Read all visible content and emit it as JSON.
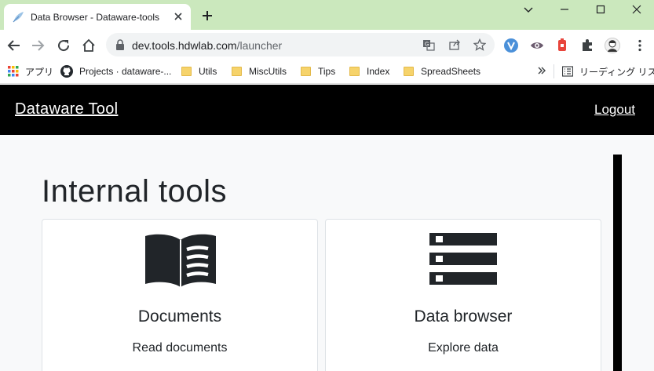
{
  "browser": {
    "tab_title": "Data Browser - Dataware-tools",
    "url_host": "dev.tools.hdwlab.com",
    "url_path": "/launcher"
  },
  "bookmarks": {
    "apps": "アプリ",
    "items": [
      "Projects · dataware-...",
      "Utils",
      "MiscUtils",
      "Tips",
      "Index",
      "SpreadSheets"
    ],
    "reading_list": "リーディング リスト"
  },
  "navbar": {
    "brand": "Dataware Tool",
    "logout": "Logout"
  },
  "main": {
    "title": "Internal tools",
    "cards": [
      {
        "title": "Documents",
        "text": "Read documents",
        "icon": "book-open-icon"
      },
      {
        "title": "Data browser",
        "text": "Explore data",
        "icon": "server-list-icon"
      }
    ]
  },
  "colors": {
    "tabstrip": "#cbe8bd",
    "navbar": "#000000",
    "content_bg": "#f8f9fa"
  }
}
